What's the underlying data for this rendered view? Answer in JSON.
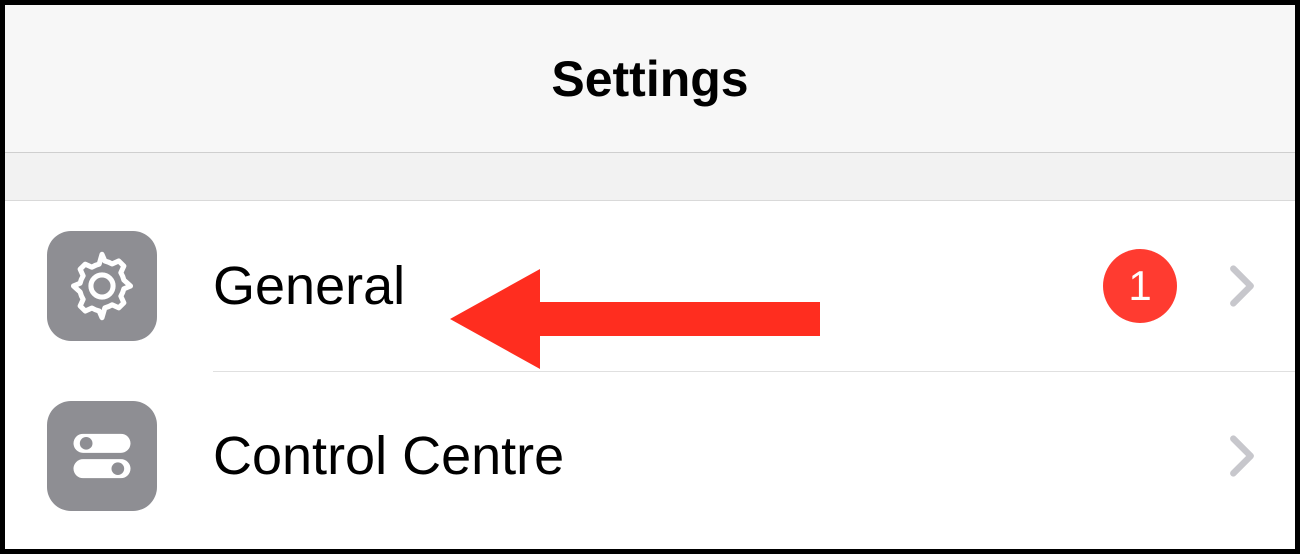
{
  "header": {
    "title": "Settings"
  },
  "rows": [
    {
      "icon": "gear-icon",
      "label": "General",
      "badge": "1",
      "has_chevron": true
    },
    {
      "icon": "switches-icon",
      "label": "Control Centre",
      "badge": null,
      "has_chevron": true
    }
  ],
  "annotation": {
    "type": "arrow-left",
    "color": "#ff2d1f"
  }
}
